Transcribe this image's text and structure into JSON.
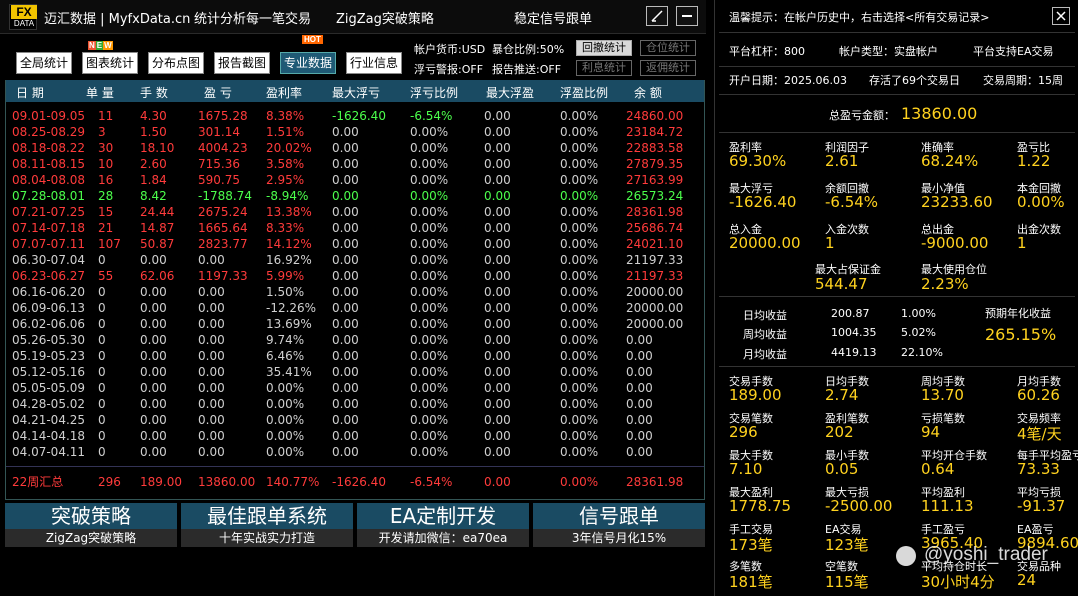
{
  "title_bar": {
    "logo_top": "FX",
    "logo_bottom": "DATA",
    "brand": "迈汇数据 | MyfxData.cn",
    "slogan": "统计分析每一笔交易",
    "strategy": "ZigZag突破策略",
    "signal": "稳定信号跟单"
  },
  "toolbar": {
    "buttons": [
      "全局统计",
      "图表统计",
      "分布点图",
      "报告截图",
      "专业数据",
      "行业信息"
    ],
    "badge_new": "NEW",
    "badge_hot": "HOT",
    "account_currency": "帐户货币:USD",
    "warehouse_ratio": "暴仓比例:50%",
    "pl_alert": "浮亏警报:OFF",
    "report_push": "报告推送:OFF",
    "side_buttons": [
      "回撤统计",
      "仓位统计",
      "利息统计",
      "返佣统计"
    ]
  },
  "table": {
    "headers": [
      "日 期",
      "单 量",
      "手 数",
      "盈 亏",
      "盈利率",
      "最大浮亏",
      "浮亏比例",
      "最大浮盈",
      "浮盈比例",
      "余 额"
    ],
    "rows": [
      {
        "date": "09.01-09.05",
        "orders": "11",
        "lots": "4.30",
        "pl": "1675.28",
        "rate": "8.38%",
        "maxloss": "-1626.40",
        "lossratio": "-6.54%",
        "maxgain": "0.00",
        "gainratio": "0.00%",
        "balance": "24860.00",
        "tone": "red"
      },
      {
        "date": "08.25-08.29",
        "orders": "3",
        "lots": "1.50",
        "pl": "301.14",
        "rate": "1.51%",
        "maxloss": "0.00",
        "lossratio": "0.00%",
        "maxgain": "0.00",
        "gainratio": "0.00%",
        "balance": "23184.72",
        "tone": "red"
      },
      {
        "date": "08.18-08.22",
        "orders": "30",
        "lots": "18.10",
        "pl": "4004.23",
        "rate": "20.02%",
        "maxloss": "0.00",
        "lossratio": "0.00%",
        "maxgain": "0.00",
        "gainratio": "0.00%",
        "balance": "22883.58",
        "tone": "red"
      },
      {
        "date": "08.11-08.15",
        "orders": "10",
        "lots": "2.60",
        "pl": "715.36",
        "rate": "3.58%",
        "maxloss": "0.00",
        "lossratio": "0.00%",
        "maxgain": "0.00",
        "gainratio": "0.00%",
        "balance": "27879.35",
        "tone": "red"
      },
      {
        "date": "08.04-08.08",
        "orders": "16",
        "lots": "1.84",
        "pl": "590.75",
        "rate": "2.95%",
        "maxloss": "0.00",
        "lossratio": "0.00%",
        "maxgain": "0.00",
        "gainratio": "0.00%",
        "balance": "27163.99",
        "tone": "red"
      },
      {
        "date": "07.28-08.01",
        "orders": "28",
        "lots": "8.42",
        "pl": "-1788.74",
        "rate": "-8.94%",
        "maxloss": "0.00",
        "lossratio": "0.00%",
        "maxgain": "0.00",
        "gainratio": "0.00%",
        "balance": "26573.24",
        "tone": "green"
      },
      {
        "date": "07.21-07.25",
        "orders": "15",
        "lots": "24.44",
        "pl": "2675.24",
        "rate": "13.38%",
        "maxloss": "0.00",
        "lossratio": "0.00%",
        "maxgain": "0.00",
        "gainratio": "0.00%",
        "balance": "28361.98",
        "tone": "red"
      },
      {
        "date": "07.14-07.18",
        "orders": "21",
        "lots": "14.87",
        "pl": "1665.64",
        "rate": "8.33%",
        "maxloss": "0.00",
        "lossratio": "0.00%",
        "maxgain": "0.00",
        "gainratio": "0.00%",
        "balance": "25686.74",
        "tone": "red"
      },
      {
        "date": "07.07-07.11",
        "orders": "107",
        "lots": "50.87",
        "pl": "2823.77",
        "rate": "14.12%",
        "maxloss": "0.00",
        "lossratio": "0.00%",
        "maxgain": "0.00",
        "gainratio": "0.00%",
        "balance": "24021.10",
        "tone": "red"
      },
      {
        "date": "06.30-07.04",
        "orders": "0",
        "lots": "0.00",
        "pl": "0.00",
        "rate": "16.92%",
        "maxloss": "0.00",
        "lossratio": "0.00%",
        "maxgain": "0.00",
        "gainratio": "0.00%",
        "balance": "21197.33",
        "tone": "gray"
      },
      {
        "date": "06.23-06.27",
        "orders": "55",
        "lots": "62.06",
        "pl": "1197.33",
        "rate": "5.99%",
        "maxloss": "0.00",
        "lossratio": "0.00%",
        "maxgain": "0.00",
        "gainratio": "0.00%",
        "balance": "21197.33",
        "tone": "red"
      },
      {
        "date": "06.16-06.20",
        "orders": "0",
        "lots": "0.00",
        "pl": "0.00",
        "rate": "1.50%",
        "maxloss": "0.00",
        "lossratio": "0.00%",
        "maxgain": "0.00",
        "gainratio": "0.00%",
        "balance": "20000.00",
        "tone": "gray"
      },
      {
        "date": "06.09-06.13",
        "orders": "0",
        "lots": "0.00",
        "pl": "0.00",
        "rate": "-12.26%",
        "maxloss": "0.00",
        "lossratio": "0.00%",
        "maxgain": "0.00",
        "gainratio": "0.00%",
        "balance": "20000.00",
        "tone": "gray"
      },
      {
        "date": "06.02-06.06",
        "orders": "0",
        "lots": "0.00",
        "pl": "0.00",
        "rate": "13.69%",
        "maxloss": "0.00",
        "lossratio": "0.00%",
        "maxgain": "0.00",
        "gainratio": "0.00%",
        "balance": "20000.00",
        "tone": "gray"
      },
      {
        "date": "05.26-05.30",
        "orders": "0",
        "lots": "0.00",
        "pl": "0.00",
        "rate": "9.74%",
        "maxloss": "0.00",
        "lossratio": "0.00%",
        "maxgain": "0.00",
        "gainratio": "0.00%",
        "balance": "0.00",
        "tone": "gray"
      },
      {
        "date": "05.19-05.23",
        "orders": "0",
        "lots": "0.00",
        "pl": "0.00",
        "rate": "6.46%",
        "maxloss": "0.00",
        "lossratio": "0.00%",
        "maxgain": "0.00",
        "gainratio": "0.00%",
        "balance": "0.00",
        "tone": "gray"
      },
      {
        "date": "05.12-05.16",
        "orders": "0",
        "lots": "0.00",
        "pl": "0.00",
        "rate": "35.41%",
        "maxloss": "0.00",
        "lossratio": "0.00%",
        "maxgain": "0.00",
        "gainratio": "0.00%",
        "balance": "0.00",
        "tone": "gray"
      },
      {
        "date": "05.05-05.09",
        "orders": "0",
        "lots": "0.00",
        "pl": "0.00",
        "rate": "0.00%",
        "maxloss": "0.00",
        "lossratio": "0.00%",
        "maxgain": "0.00",
        "gainratio": "0.00%",
        "balance": "0.00",
        "tone": "gray"
      },
      {
        "date": "04.28-05.02",
        "orders": "0",
        "lots": "0.00",
        "pl": "0.00",
        "rate": "0.00%",
        "maxloss": "0.00",
        "lossratio": "0.00%",
        "maxgain": "0.00",
        "gainratio": "0.00%",
        "balance": "0.00",
        "tone": "gray"
      },
      {
        "date": "04.21-04.25",
        "orders": "0",
        "lots": "0.00",
        "pl": "0.00",
        "rate": "0.00%",
        "maxloss": "0.00",
        "lossratio": "0.00%",
        "maxgain": "0.00",
        "gainratio": "0.00%",
        "balance": "0.00",
        "tone": "gray"
      },
      {
        "date": "04.14-04.18",
        "orders": "0",
        "lots": "0.00",
        "pl": "0.00",
        "rate": "0.00%",
        "maxloss": "0.00",
        "lossratio": "0.00%",
        "maxgain": "0.00",
        "gainratio": "0.00%",
        "balance": "0.00",
        "tone": "gray"
      },
      {
        "date": "04.07-04.11",
        "orders": "0",
        "lots": "0.00",
        "pl": "0.00",
        "rate": "0.00%",
        "maxloss": "0.00",
        "lossratio": "0.00%",
        "maxgain": "0.00",
        "gainratio": "0.00%",
        "balance": "0.00",
        "tone": "gray"
      }
    ],
    "summary": {
      "date": "22周汇总",
      "orders": "296",
      "lots": "189.00",
      "pl": "13860.00",
      "rate": "140.77%",
      "maxloss": "-1626.40",
      "lossratio": "-6.54%",
      "maxgain": "0.00",
      "gainratio": "0.00%",
      "balance": "28361.98"
    }
  },
  "banners": [
    {
      "title": "突破策略",
      "sub": "ZigZag突破策略"
    },
    {
      "title": "最佳跟单系统",
      "sub": "十年实战实力打造"
    },
    {
      "title": "EA定制开发",
      "sub": "开发请加微信：ea70ea"
    },
    {
      "title": "信号跟单",
      "sub": "3年信号月化15%"
    }
  ],
  "right": {
    "tip": "温馨提示：在帐户历史中，右击选择<所有交易记录>",
    "leverage": "平台杠杆：800",
    "account_type": "帐户类型：实盘帐户",
    "ea_support": "平台支持EA交易",
    "open_date": "开户日期：2025.06.03",
    "survival": "存活了69个交易日",
    "cycle": "交易周期：15周",
    "total_pl_label": "总盈亏金额：",
    "total_pl": "13860.00",
    "stats1": [
      {
        "label": "盈利率",
        "value": "69.30%"
      },
      {
        "label": "利润因子",
        "value": "2.61"
      },
      {
        "label": "准确率",
        "value": "68.24%"
      },
      {
        "label": "盈亏比",
        "value": "1.22"
      },
      {
        "label": "最大浮亏",
        "value": "-1626.40"
      },
      {
        "label": "余额回撤",
        "value": "-6.54%"
      },
      {
        "label": "最小净值",
        "value": "23233.60"
      },
      {
        "label": "本金回撤",
        "value": "0.00%"
      },
      {
        "label": "总入金",
        "value": "20000.00"
      },
      {
        "label": "入金次数",
        "value": "1"
      },
      {
        "label": "总出金",
        "value": "-9000.00"
      },
      {
        "label": "出金次数",
        "value": "1"
      }
    ],
    "margin_label": "最大占保证金",
    "margin_value": "544.47",
    "position_label": "最大使用仓位",
    "position_value": "2.23%",
    "daily_label": "日均收益",
    "daily_amount": "200.87",
    "daily_pct": "1.00%",
    "weekly_label": "周均收益",
    "weekly_amount": "1004.35",
    "weekly_pct": "5.02%",
    "monthly_label": "月均收益",
    "monthly_amount": "4419.13",
    "monthly_pct": "22.10%",
    "annual_label": "预期年化收益",
    "annual_value": "265.15%",
    "stats2": [
      {
        "label": "交易手数",
        "value": "189.00"
      },
      {
        "label": "日均手数",
        "value": "2.74"
      },
      {
        "label": "周均手数",
        "value": "13.70"
      },
      {
        "label": "月均手数",
        "value": "60.26"
      },
      {
        "label": "交易笔数",
        "value": "296"
      },
      {
        "label": "盈利笔数",
        "value": "202"
      },
      {
        "label": "亏损笔数",
        "value": "94"
      },
      {
        "label": "交易频率",
        "value": "4笔/天"
      },
      {
        "label": "最大手数",
        "value": "7.10"
      },
      {
        "label": "最小手数",
        "value": "0.05"
      },
      {
        "label": "平均开仓手数",
        "value": "0.64"
      },
      {
        "label": "每手平均盈亏",
        "value": "73.33"
      },
      {
        "label": "最大盈利",
        "value": "1778.75"
      },
      {
        "label": "最大亏损",
        "value": "-2500.00"
      },
      {
        "label": "平均盈利",
        "value": "111.13"
      },
      {
        "label": "平均亏损",
        "value": "-91.37"
      },
      {
        "label": "手工交易",
        "value": "173笔"
      },
      {
        "label": "EA交易",
        "value": "123笔"
      },
      {
        "label": "手工盈亏",
        "value": "3965.40"
      },
      {
        "label": "EA盈亏",
        "value": "9894.60"
      },
      {
        "label": "多笔数",
        "value": "181笔"
      },
      {
        "label": "空笔数",
        "value": "115笔"
      },
      {
        "label": "平均持仓时长",
        "value": "30小时4分"
      },
      {
        "label": "交易品种",
        "value": "24"
      }
    ]
  },
  "watermark": "@yoshi_trader",
  "colors": {
    "red": "#ff3b3b",
    "green": "#4cff4c",
    "gray": "#d0d0d0",
    "value": "#ffd21f",
    "header": "#1a4b63"
  }
}
